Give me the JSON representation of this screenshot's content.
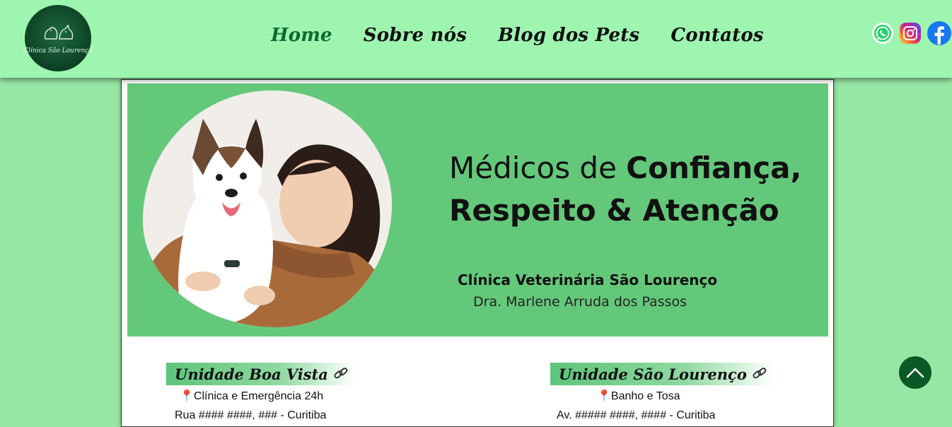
{
  "header": {
    "logo_text": "Clínica São Lourenço",
    "nav": [
      {
        "label": "Home",
        "active": true
      },
      {
        "label": "Sobre nós",
        "active": false
      },
      {
        "label": "Blog dos Pets",
        "active": false
      },
      {
        "label": "Contatos",
        "active": false
      }
    ],
    "social": [
      "whatsapp-icon",
      "instagram-icon",
      "facebook-icon"
    ]
  },
  "banner": {
    "line1_light": "Médicos de",
    "line1_bold": "Confiança,",
    "line2": "Respeito & Atenção",
    "clinic": "Clínica Veterinária São Lourenço",
    "doctor": "Dra. Marlene Arruda dos Passos"
  },
  "units": [
    {
      "title": "Unidade Boa Vista",
      "service": "Clínica e Emergência 24h",
      "address": "Rua #### ####, ### - Curitiba"
    },
    {
      "title": "Unidade São Lourenço",
      "service": "Banho e Tosa",
      "address": "Av. ##### ####, #### - Curitiba"
    }
  ],
  "colors": {
    "header_bg": "#9ef5b0",
    "page_bg": "#98e6a4",
    "banner_bg": "#64c87b",
    "active_nav": "#0d6b2f",
    "scroll_button": "#0a5a28"
  }
}
